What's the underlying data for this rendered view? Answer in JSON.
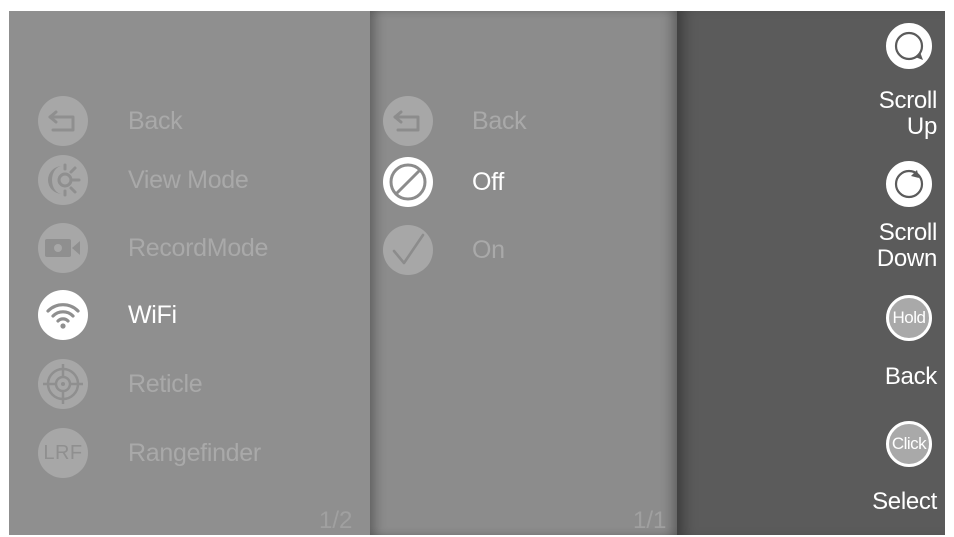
{
  "left_menu": {
    "items": [
      {
        "label": "Back",
        "icon": "back-arrow-icon",
        "active": false
      },
      {
        "label": "View Mode",
        "icon": "view-mode-icon",
        "active": false
      },
      {
        "label": "RecordMode",
        "icon": "video-camera-icon",
        "active": false
      },
      {
        "label": "WiFi",
        "icon": "wifi-icon",
        "active": true
      },
      {
        "label": "Reticle",
        "icon": "crosshair-icon",
        "active": false
      },
      {
        "label": "Rangefinder",
        "icon": "lrf-icon",
        "icon_text": "LRF",
        "active": false
      }
    ],
    "page": "1/2"
  },
  "sub_menu": {
    "items": [
      {
        "label": "Back",
        "icon": "back-arrow-icon",
        "active": false
      },
      {
        "label": "Off",
        "icon": "off-slash-icon",
        "active": true
      },
      {
        "label": "On",
        "icon": "check-icon",
        "active": false
      }
    ],
    "page": "1/1"
  },
  "controls": {
    "scroll_up": "Scroll Up",
    "scroll_up_line1": "Scroll",
    "scroll_up_line2": "Up",
    "scroll_down_line1": "Scroll",
    "scroll_down_line2": "Down",
    "hold_badge": "Hold",
    "back_label": "Back",
    "click_badge": "Click",
    "select_label": "Select"
  },
  "colors": {
    "left_panel": "#8f8f8f",
    "middle_panel": "#8c8c8c",
    "right_panel": "#5b5b5b",
    "inactive_text": "#a9a9a9",
    "active_text": "#ffffff"
  }
}
